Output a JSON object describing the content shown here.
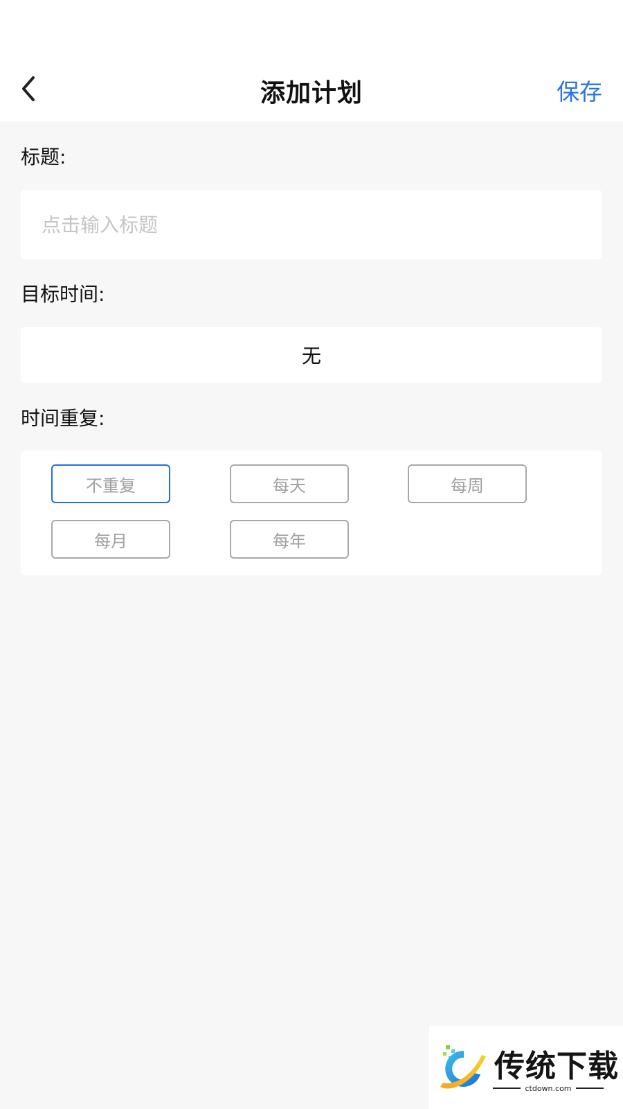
{
  "header": {
    "title": "添加计划",
    "save_label": "保存",
    "back_icon": "chevron-left-icon"
  },
  "form": {
    "title_label": "标题:",
    "title_placeholder": "点击输入标题",
    "title_value": "",
    "target_time_label": "目标时间:",
    "target_time_value": "无",
    "repeat_label": "时间重复:",
    "repeat_options": [
      "不重复",
      "每天",
      "每周",
      "每月",
      "每年"
    ],
    "repeat_selected": "不重复"
  },
  "watermark": {
    "brand": "传统下载",
    "url": "ctdown.com"
  },
  "colors": {
    "accent": "#2a74e0",
    "selected_border": "#1f6fe0",
    "background": "#f7f7f7"
  }
}
